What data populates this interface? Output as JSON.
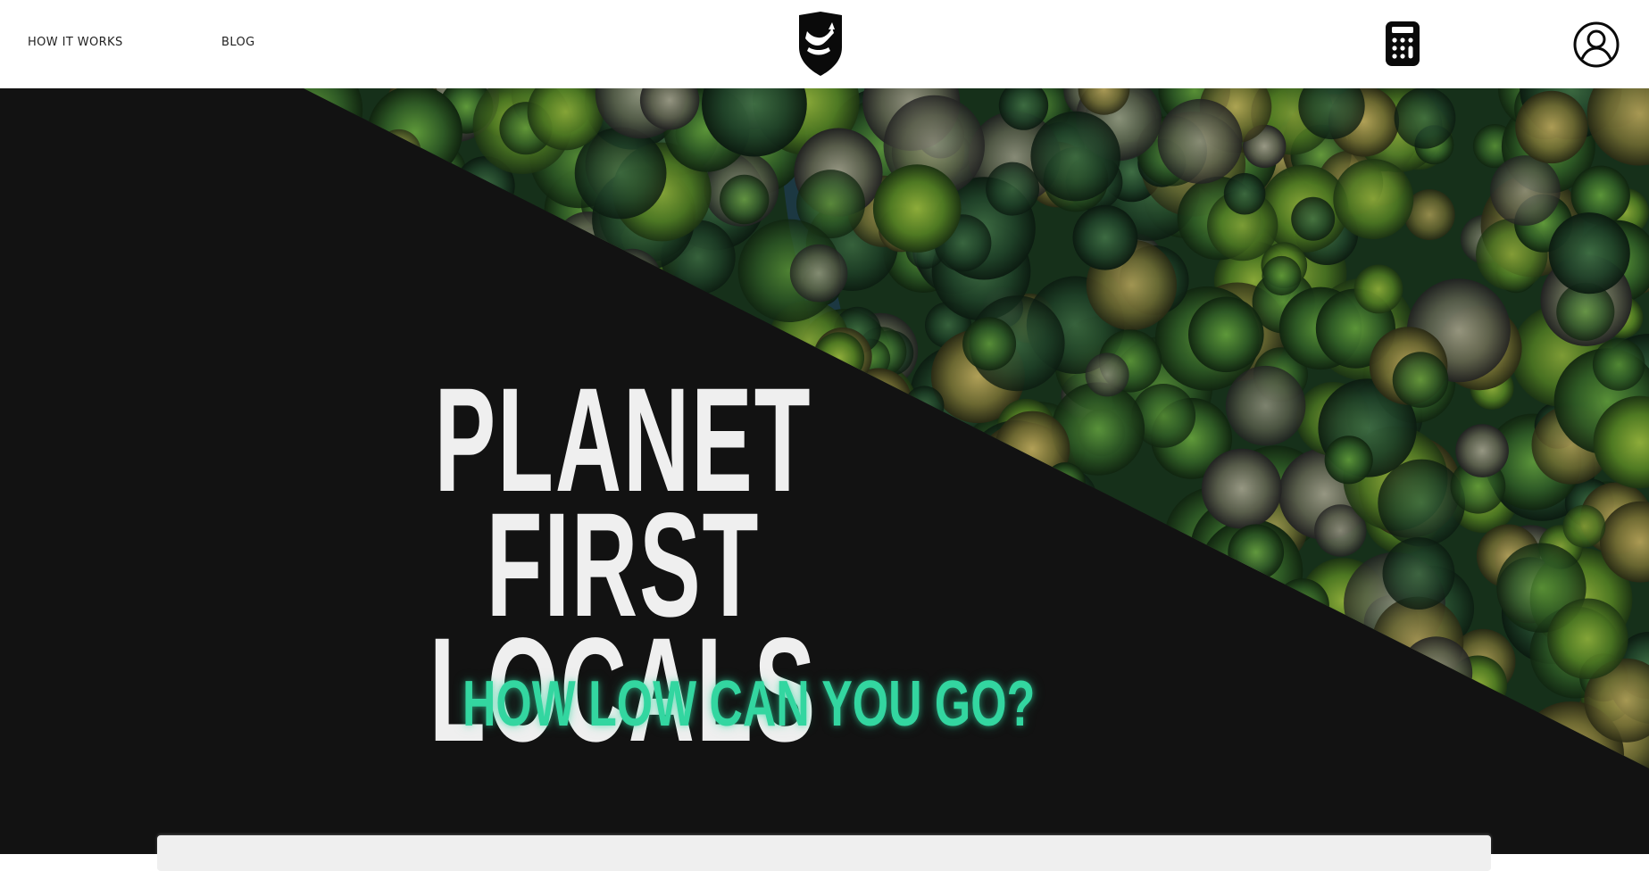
{
  "header": {
    "nav": [
      {
        "label": "HOW IT WORKS"
      },
      {
        "label": "BLOG"
      }
    ],
    "logo_icon": "shield-logo-icon",
    "calculator_icon": "calculator-icon",
    "account_icon": "user-account-icon"
  },
  "hero": {
    "headline_line1": "PLANET FIRST",
    "headline_line2": "LOCALS",
    "tagline": "HOW LOW CAN YOU GO?",
    "colors": {
      "background": "#121212",
      "headline": "#efefef",
      "tagline": "#33d6a0"
    }
  }
}
